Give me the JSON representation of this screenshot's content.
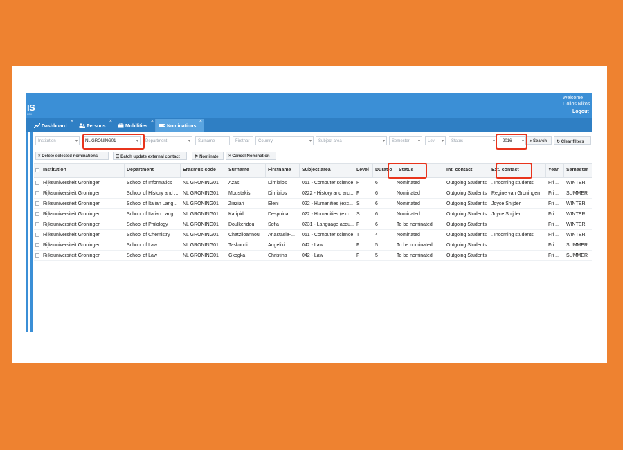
{
  "app": {
    "logo": "IS",
    "logo_sub": "UNI",
    "welcome": "Welcome",
    "user": "Liolios Nikos",
    "logout": "Logout"
  },
  "tabs": [
    {
      "label": "Dashboard",
      "icon": "chart-line-icon",
      "close": "×"
    },
    {
      "label": "Persons",
      "icon": "persons-icon",
      "close": "×"
    },
    {
      "label": "Mobilities",
      "icon": "mobilities-icon",
      "close": "×"
    },
    {
      "label": "Nominations",
      "icon": "nominations-icon",
      "close": "×",
      "active": true
    }
  ],
  "filters": {
    "institution": "Institution",
    "institution_value": "NL GRONING01",
    "department": "Department",
    "surname": "Surname",
    "firstname": "Firstnar",
    "country": "Country",
    "subject_area": "Subject area",
    "semester": "Semester",
    "level": "Lev",
    "status": "Status",
    "year": "2016",
    "search": "Search",
    "clear": "Clear filters"
  },
  "actions": {
    "delete": "Delete selected nominations",
    "batch": "Batch update external contact",
    "nominate": "Nominate",
    "cancel": "Cancel Nomination"
  },
  "columns": [
    "Institution",
    "Department",
    "Erasmus code",
    "Surname",
    "Firstname",
    "Subject area",
    "Level",
    "Duration",
    "Status",
    "Int. contact",
    "Ext. contact",
    "Year",
    "Semester"
  ],
  "rows": [
    [
      "Rijksuniversiteit Groningen",
      "School of Informatics",
      "NL GRONING01",
      "Azas",
      "Dimitrios",
      "061 - Computer science",
      "F",
      "6",
      "Nominated",
      "Outgoing Students",
      ". Incoming students",
      "Fri ...",
      "WINTER"
    ],
    [
      "Rijksuniversiteit Groningen",
      "School of History and ...",
      "NL GRONING01",
      "Moustakis",
      "Dimitrios",
      "0222 - History and arc...",
      "F",
      "6",
      "Nominated",
      "Outgoing Students",
      "Regine van Groningen",
      "Fri ...",
      "SUMMER"
    ],
    [
      "Rijksuniversiteit Groningen",
      "School of Italian Lang...",
      "NL GRONING01",
      "Ziaziari",
      "Eleni",
      "022 - Humanities (exc...",
      "S",
      "6",
      "Nominated",
      "Outgoing Students",
      "Joyce Snijder",
      "Fri ...",
      "WINTER"
    ],
    [
      "Rijksuniversiteit Groningen",
      "School of Italian Lang...",
      "NL GRONING01",
      "Karipidi",
      "Despoina",
      "022 - Humanities (exc...",
      "S",
      "6",
      "Nominated",
      "Outgoing Students",
      "Joyce Snijder",
      "Fri ...",
      "WINTER"
    ],
    [
      "Rijksuniversiteit Groningen",
      "School of Philology",
      "NL GRONING01",
      "Doulkeridou",
      "Sofia",
      "0231 - Language acqu...",
      "F",
      "6",
      "To be nominated",
      "Outgoing Students",
      "",
      "Fri ...",
      "WINTER"
    ],
    [
      "Rijksuniversiteit Groningen",
      "School of Chemistry",
      "NL GRONING01",
      "Chatziioannou",
      "Anastasia-...",
      "061 - Computer science",
      "T",
      "4",
      "Nominated",
      "Outgoing Students",
      ". Incoming students",
      "Fri ...",
      "WINTER"
    ],
    [
      "Rijksuniversiteit Groningen",
      "School of Law",
      "NL GRONING01",
      "Taskoudi",
      "Angeliki",
      "042 - Law",
      "F",
      "5",
      "To be nominated",
      "Outgoing Students",
      "",
      "Fri ...",
      "SUMMER"
    ],
    [
      "Rijksuniversiteit Groningen",
      "School of Law",
      "NL GRONING01",
      "Gkogka",
      "Christina",
      "042 - Law",
      "F",
      "5",
      "To be nominated",
      "Outgoing Students",
      "",
      "Fri ...",
      "SUMMER"
    ]
  ],
  "colors": {
    "background": "#ee8230",
    "topbar": "#3b8fd6",
    "tabbar": "#2f7fc4",
    "active_tab": "#5aa4e0",
    "highlight": "#e8341c"
  }
}
